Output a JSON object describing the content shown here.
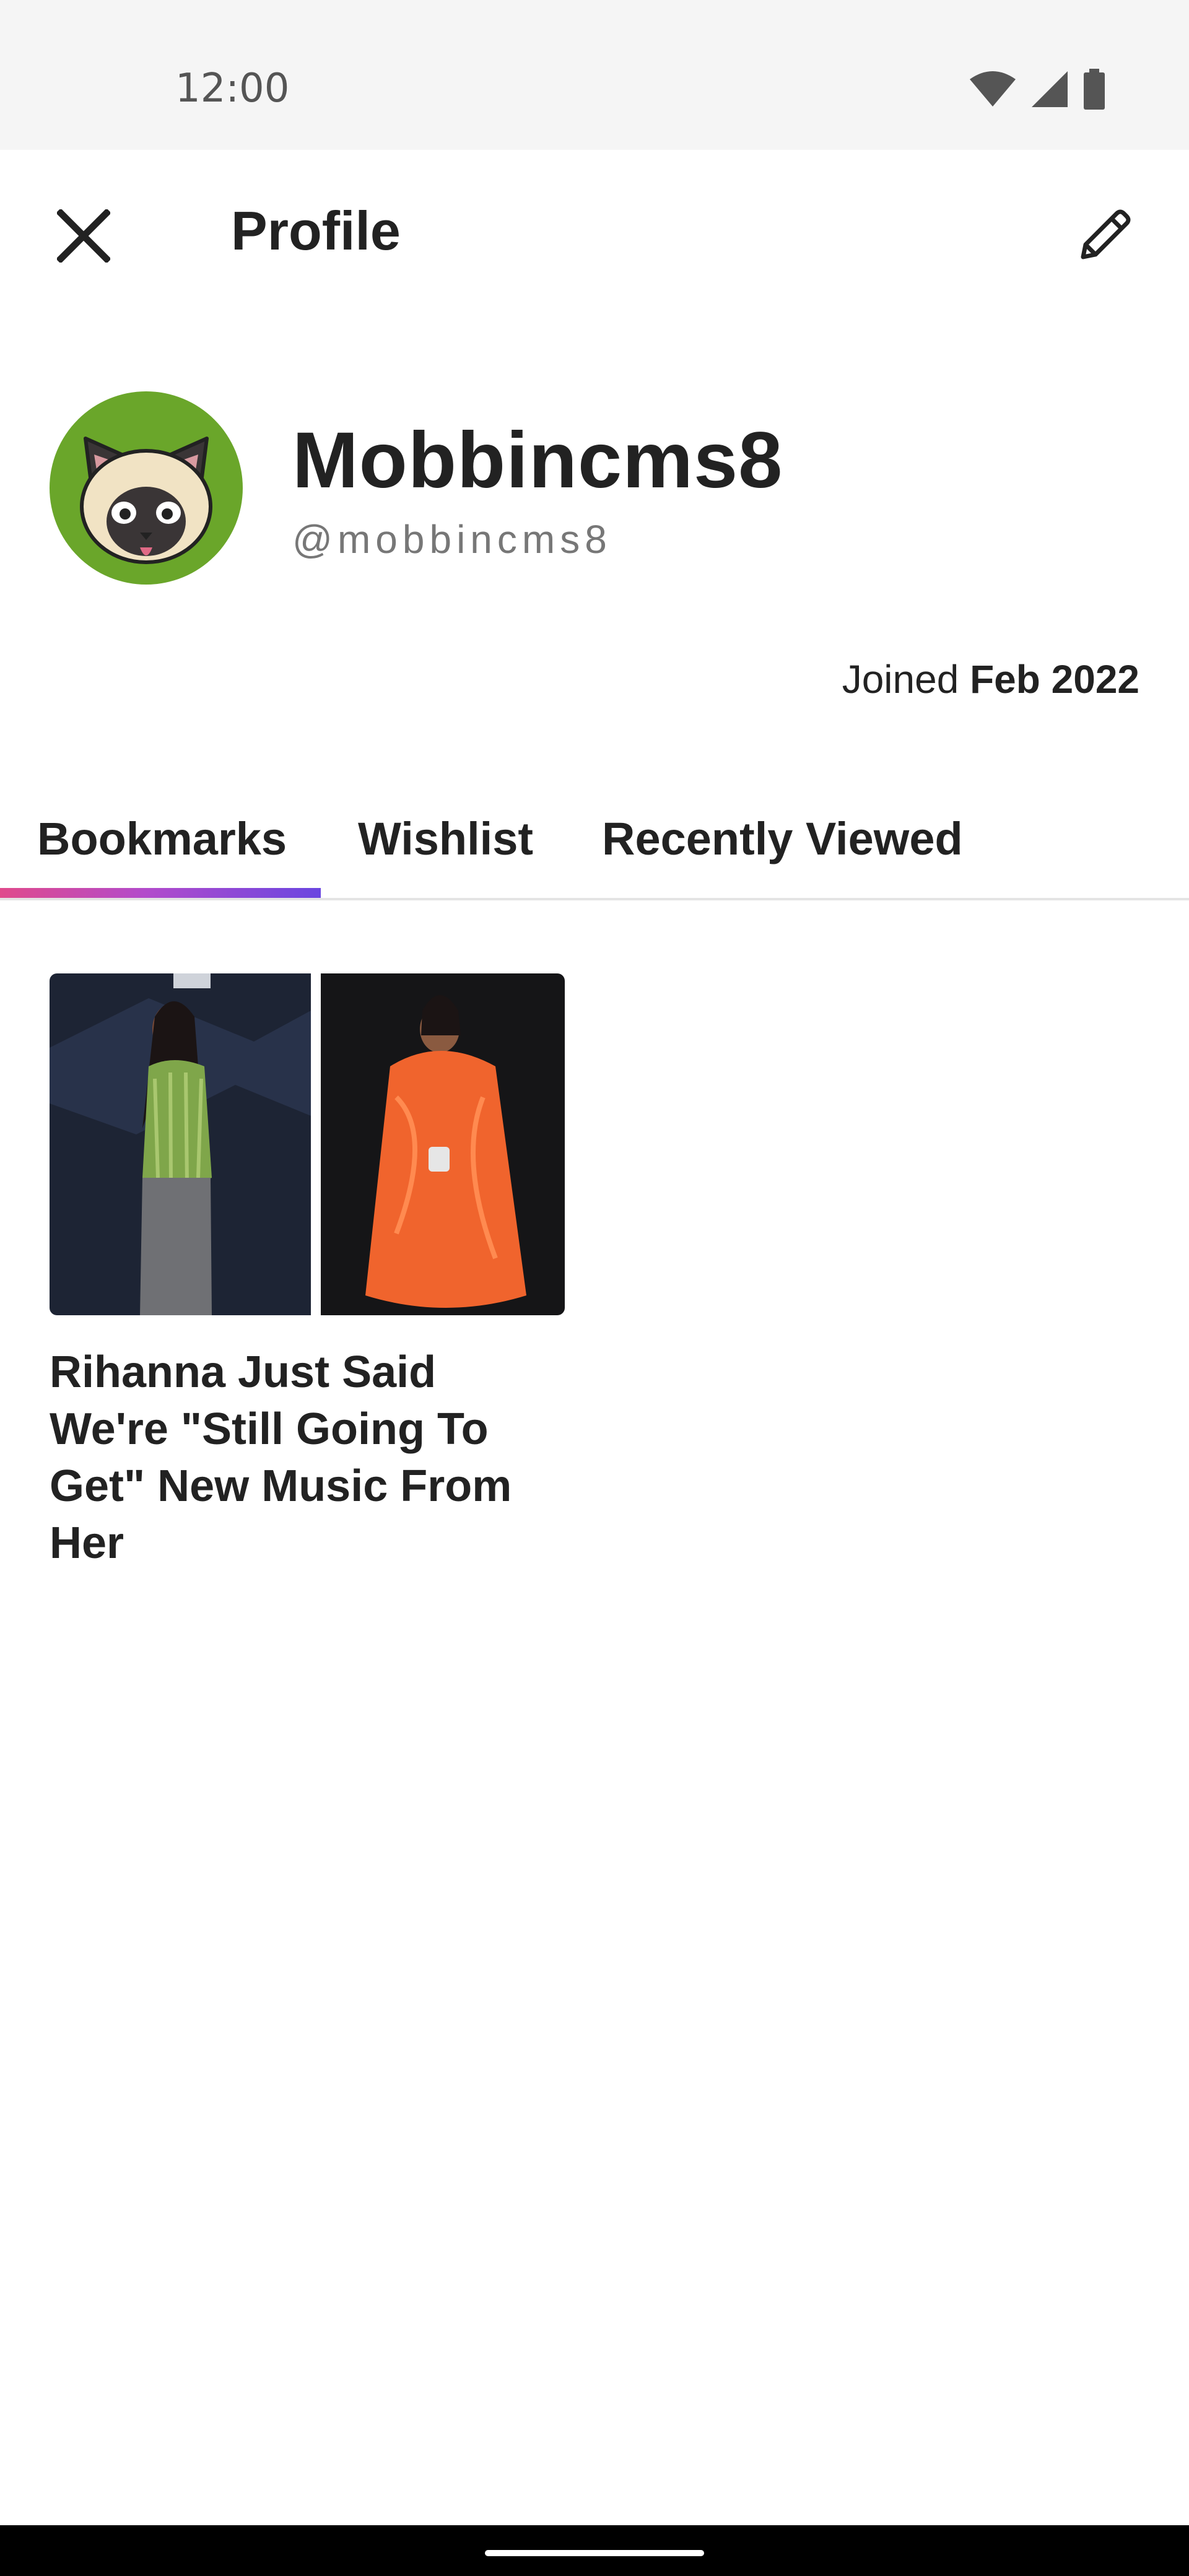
{
  "status_bar": {
    "time": "12:00",
    "icons": [
      "wifi-icon",
      "signal-icon",
      "battery-icon"
    ]
  },
  "app_bar": {
    "title": "Profile",
    "close_icon": "close-icon",
    "edit_icon": "pencil-icon"
  },
  "profile": {
    "display_name": "Mobbincms8",
    "username": "@mobbincms8",
    "joined_prefix": "Joined",
    "joined_date": "Feb 2022",
    "avatar_background": "#6aa62a"
  },
  "tabs": [
    {
      "label": "Bookmarks",
      "selected": true
    },
    {
      "label": "Wishlist",
      "selected": false
    },
    {
      "label": "Recently Viewed",
      "selected": false
    }
  ],
  "bookmarks": [
    {
      "title": "Rihanna Just Said We're \"Still Going To Get\" New Music From Her"
    }
  ],
  "colors": {
    "tab_indicator_start": "#e04a8c",
    "tab_indicator_end": "#6a46e0",
    "text": "#222222"
  }
}
